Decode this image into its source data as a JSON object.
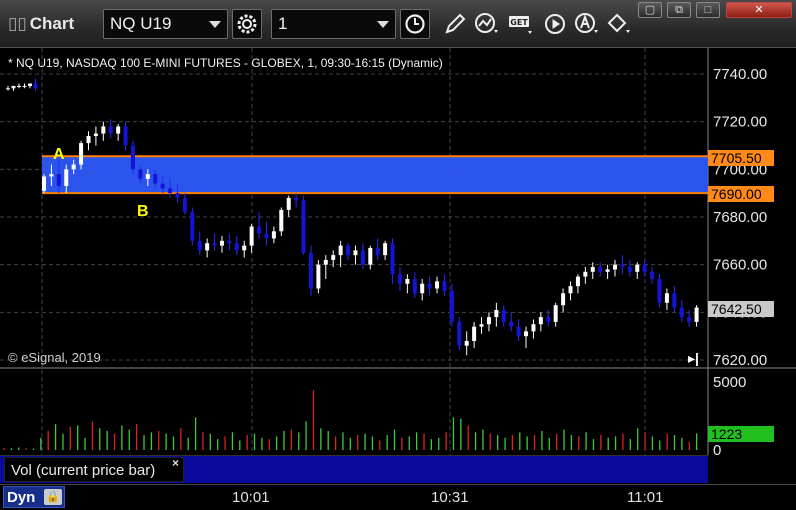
{
  "toolbar": {
    "title": "Chart",
    "symbol": "NQ U19",
    "interval": "1",
    "icons": [
      "settings-gear-icon",
      "clock-icon",
      "pencil-draw-icon",
      "study-icon",
      "get-data-icon",
      "play-replay-icon",
      "alert-icon",
      "link-icon"
    ],
    "window_buttons": [
      "restore",
      "maximize",
      "close"
    ]
  },
  "chart": {
    "description": "* NQ U19, NASDAQ 100 E-MINI FUTURES - GLOBEX, 1, 09:30-16:15 (Dynamic)",
    "copyright": "© eSignal, 2019",
    "point_a": "A",
    "point_b": "B",
    "upper_line_tag": "7705.50",
    "lower_line_tag": "7690.00",
    "last_price_tag": "7642.50",
    "vol_last_tag": "1223",
    "vol_label": "Vol (current price bar)",
    "vol_close": "×",
    "dyn_label": "Dyn",
    "zone_color": "#2f5bff",
    "zone_border": "#ff7f00",
    "up_color": "#ffffff",
    "down_color": "#1414d9"
  },
  "chart_data": {
    "type": "candlestick",
    "price_axis": {
      "ticks": [
        "7740.00",
        "7720.00",
        "7700.00",
        "7680.00",
        "7660.00",
        "7640.00",
        "7620.00"
      ],
      "range": [
        7615,
        7747
      ]
    },
    "volume_axis": {
      "ticks": [
        "5000",
        "0"
      ],
      "range": [
        0,
        5400
      ]
    },
    "time_axis": {
      "ticks": [
        "10:01",
        "10:31",
        "11:01"
      ]
    },
    "zone": {
      "upper": 7705.5,
      "lower": 7690.0
    },
    "last_price": 7642.5,
    "candles": [
      [
        7734,
        7735,
        7733,
        7734
      ],
      [
        7734,
        7735,
        7733,
        7735
      ],
      [
        7735,
        7736,
        7734,
        7735
      ],
      [
        7735,
        7736,
        7734,
        7735
      ],
      [
        7735,
        7736,
        7734,
        7736
      ],
      [
        7736,
        7738,
        7733,
        7734
      ],
      [
        7691,
        7698,
        7690,
        7697
      ],
      [
        7697,
        7702,
        7693,
        7698
      ],
      [
        7698,
        7706,
        7690,
        7693
      ],
      [
        7693,
        7702,
        7690,
        7700
      ],
      [
        7700,
        7704,
        7698,
        7702
      ],
      [
        7702,
        7712,
        7700,
        7711
      ],
      [
        7711,
        7716,
        7708,
        7714
      ],
      [
        7714,
        7718,
        7710,
        7715
      ],
      [
        7715,
        7720,
        7712,
        7718
      ],
      [
        7718,
        7721,
        7713,
        7715
      ],
      [
        7715,
        7719,
        7712,
        7718
      ],
      [
        7718,
        7720,
        7708,
        7710
      ],
      [
        7710,
        7712,
        7698,
        7700
      ],
      [
        7700,
        7702,
        7694,
        7696
      ],
      [
        7696,
        7700,
        7693,
        7698
      ],
      [
        7698,
        7700,
        7692,
        7694
      ],
      [
        7694,
        7697,
        7690,
        7692
      ],
      [
        7692,
        7696,
        7688,
        7690
      ],
      [
        7690,
        7694,
        7686,
        7688
      ],
      [
        7688,
        7690,
        7681,
        7682
      ],
      [
        7682,
        7684,
        7668,
        7670
      ],
      [
        7670,
        7674,
        7664,
        7666
      ],
      [
        7666,
        7671,
        7663,
        7669
      ],
      [
        7669,
        7673,
        7666,
        7668
      ],
      [
        7668,
        7672,
        7665,
        7670
      ],
      [
        7670,
        7673,
        7666,
        7669
      ],
      [
        7669,
        7672,
        7664,
        7666
      ],
      [
        7666,
        7670,
        7663,
        7668
      ],
      [
        7668,
        7677,
        7665,
        7676
      ],
      [
        7676,
        7682,
        7671,
        7673
      ],
      [
        7673,
        7678,
        7668,
        7671
      ],
      [
        7671,
        7676,
        7669,
        7674
      ],
      [
        7674,
        7684,
        7672,
        7683
      ],
      [
        7683,
        7689,
        7680,
        7688
      ],
      [
        7688,
        7690,
        7684,
        7687
      ],
      [
        7687,
        7689,
        7664,
        7665
      ],
      [
        7665,
        7668,
        7647,
        7650
      ],
      [
        7650,
        7662,
        7648,
        7660
      ],
      [
        7660,
        7664,
        7654,
        7662
      ],
      [
        7662,
        7666,
        7659,
        7664
      ],
      [
        7664,
        7670,
        7659,
        7668
      ],
      [
        7668,
        7669,
        7662,
        7664
      ],
      [
        7664,
        7668,
        7660,
        7666
      ],
      [
        7666,
        7669,
        7658,
        7660
      ],
      [
        7660,
        7668,
        7658,
        7667
      ],
      [
        7667,
        7671,
        7662,
        7664
      ],
      [
        7664,
        7670,
        7662,
        7669
      ],
      [
        7669,
        7671,
        7652,
        7656
      ],
      [
        7656,
        7659,
        7649,
        7652
      ],
      [
        7652,
        7656,
        7648,
        7654
      ],
      [
        7654,
        7657,
        7646,
        7648
      ],
      [
        7648,
        7654,
        7645,
        7652
      ],
      [
        7652,
        7655,
        7647,
        7650
      ],
      [
        7650,
        7655,
        7648,
        7653
      ],
      [
        7653,
        7656,
        7647,
        7649
      ],
      [
        7649,
        7652,
        7634,
        7636
      ],
      [
        7636,
        7638,
        7624,
        7626
      ],
      [
        7626,
        7632,
        7622,
        7628
      ],
      [
        7628,
        7636,
        7625,
        7634
      ],
      [
        7634,
        7638,
        7631,
        7635
      ],
      [
        7635,
        7640,
        7632,
        7638
      ],
      [
        7638,
        7644,
        7634,
        7641
      ],
      [
        7641,
        7643,
        7634,
        7636
      ],
      [
        7636,
        7640,
        7632,
        7634
      ],
      [
        7634,
        7637,
        7628,
        7630
      ],
      [
        7630,
        7634,
        7625,
        7632
      ],
      [
        7632,
        7637,
        7629,
        7635
      ],
      [
        7635,
        7640,
        7632,
        7638
      ],
      [
        7638,
        7641,
        7634,
        7636
      ],
      [
        7636,
        7644,
        7634,
        7643
      ],
      [
        7643,
        7650,
        7640,
        7648
      ],
      [
        7648,
        7653,
        7645,
        7651
      ],
      [
        7651,
        7656,
        7648,
        7655
      ],
      [
        7655,
        7659,
        7652,
        7657
      ],
      [
        7657,
        7661,
        7654,
        7659
      ],
      [
        7659,
        7661,
        7655,
        7657
      ],
      [
        7657,
        7660,
        7654,
        7658
      ],
      [
        7658,
        7662,
        7655,
        7660
      ],
      [
        7660,
        7664,
        7656,
        7659
      ],
      [
        7659,
        7662,
        7655,
        7657
      ],
      [
        7657,
        7661,
        7654,
        7660
      ],
      [
        7660,
        7662,
        7655,
        7657
      ],
      [
        7657,
        7659,
        7652,
        7654
      ],
      [
        7654,
        7656,
        7642,
        7644
      ],
      [
        7644,
        7650,
        7641,
        7648
      ],
      [
        7648,
        7651,
        7640,
        7642
      ],
      [
        7642,
        7645,
        7636,
        7638
      ],
      [
        7638,
        7641,
        7634,
        7636
      ],
      [
        7636,
        7643,
        7634,
        7642
      ]
    ],
    "volume": [
      150,
      120,
      180,
      140,
      110,
      900,
      1400,
      1900,
      1200,
      1700,
      1800,
      900,
      2100,
      1600,
      1400,
      1200,
      1800,
      1500,
      1900,
      1100,
      1300,
      1400,
      1200,
      1000,
      1600,
      900,
      2400,
      1300,
      1200,
      800,
      1000,
      1300,
      700,
      1100,
      1200,
      900,
      800,
      1000,
      1400,
      1500,
      1300,
      2100,
      4400,
      1600,
      1400,
      1000,
      1300,
      900,
      1100,
      1200,
      1000,
      700,
      1100,
      1500,
      900,
      1000,
      1300,
      1200,
      800,
      900,
      1300,
      2400,
      2300,
      1800,
      1300,
      1500,
      1200,
      1100,
      900,
      1100,
      1300,
      1000,
      1100,
      1400,
      900,
      1200,
      1500,
      1100,
      1000,
      1300,
      800,
      1100,
      900,
      1000,
      1200,
      800,
      1600,
      1300,
      1000,
      700,
      1200,
      1100,
      900,
      600,
      1223
    ]
  }
}
